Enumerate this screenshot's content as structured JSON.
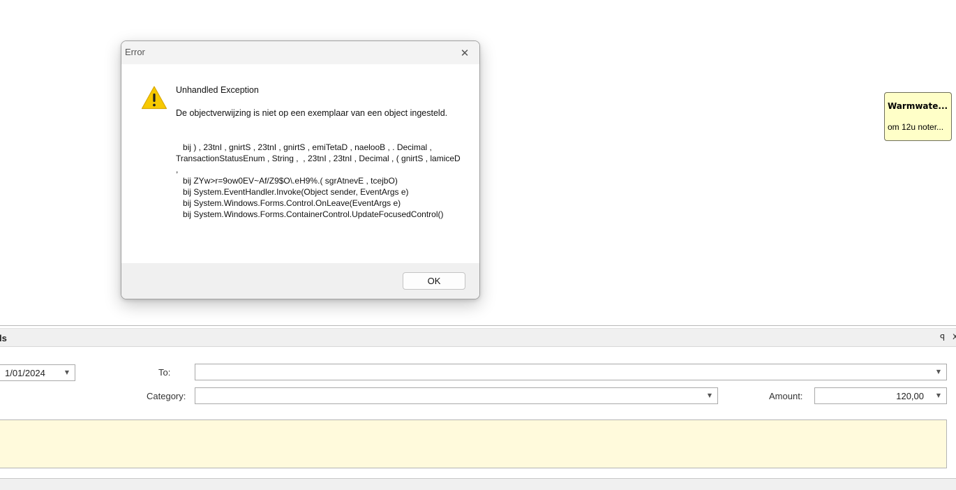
{
  "dialog": {
    "title": "Error",
    "close_glyph": "✕",
    "icon": "warning-icon",
    "heading": "Unhandled Exception",
    "message": "De objectverwijzing is niet op een exemplaar van een object ingesteld.",
    "stack_trace": "   bij ) , 23tnI , gnirtS , 23tnI , gnirtS , emiTetaD , naelooB , . Decimal , TransactionStatusEnum , String ,  , 23tnI , 23tnI , Decimal , ( gnirtS , lamiceD ,\n   bij ZYw>r=9ow0EV~Af/Z9$O\\.eH9%.( sgrAtnevE , tcejbO)\n   bij System.EventHandler.Invoke(Object sender, EventArgs e)\n   bij System.Windows.Forms.Control.OnLeave(EventArgs e)\n   bij System.Windows.Forms.ContainerControl.UpdateFocusedControl()",
    "ok_label": "OK"
  },
  "note": {
    "title": "Warmwate...",
    "body": "om 12u noter..."
  },
  "panel": {
    "title": "ls",
    "pin_glyph": "ꟼ",
    "close_glyph": "x",
    "date_value": "1/01/2024",
    "to_label": "To:",
    "to_value": "",
    "category_label": "Category:",
    "category_value": "",
    "amount_label": "Amount:",
    "amount_value": "120,00",
    "dropdown_glyph": "▼"
  },
  "colors": {
    "memo_background": "#fffadc",
    "note_background": "#ffffc8",
    "warning_yellow": "#f7c900"
  }
}
